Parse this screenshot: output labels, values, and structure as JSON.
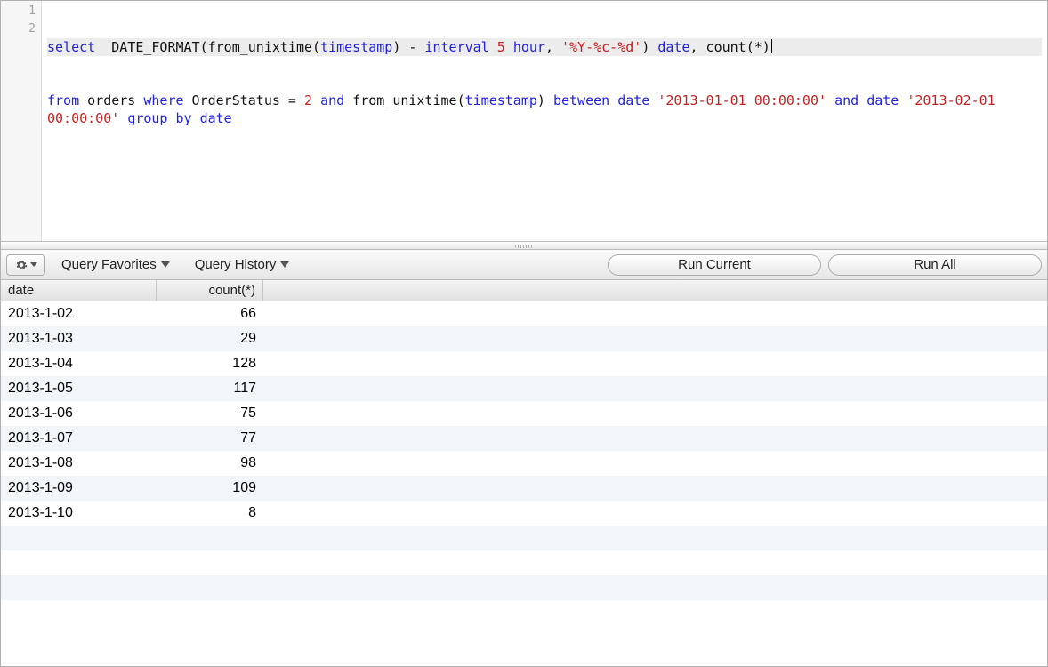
{
  "editor": {
    "line_numbers": [
      "1",
      "2"
    ],
    "tokens_line1": [
      {
        "t": "select",
        "c": "kw"
      },
      {
        "t": "  ",
        "c": ""
      },
      {
        "t": "DATE_FORMAT",
        "c": "fn"
      },
      {
        "t": "(",
        "c": ""
      },
      {
        "t": "from_unixtime",
        "c": "fn"
      },
      {
        "t": "(",
        "c": ""
      },
      {
        "t": "timestamp",
        "c": "kw"
      },
      {
        "t": ") - ",
        "c": ""
      },
      {
        "t": "interval",
        "c": "kw"
      },
      {
        "t": " ",
        "c": ""
      },
      {
        "t": "5",
        "c": "num"
      },
      {
        "t": " ",
        "c": ""
      },
      {
        "t": "hour",
        "c": "kw"
      },
      {
        "t": ", ",
        "c": ""
      },
      {
        "t": "'%Y-%c-%d'",
        "c": "str"
      },
      {
        "t": ") ",
        "c": ""
      },
      {
        "t": "date",
        "c": "kw"
      },
      {
        "t": ", count(*)",
        "c": ""
      }
    ],
    "tokens_line2": [
      {
        "t": "from",
        "c": "kw"
      },
      {
        "t": " orders ",
        "c": ""
      },
      {
        "t": "where",
        "c": "kw"
      },
      {
        "t": " OrderStatus = ",
        "c": ""
      },
      {
        "t": "2",
        "c": "num"
      },
      {
        "t": " ",
        "c": ""
      },
      {
        "t": "and",
        "c": "kw"
      },
      {
        "t": " ",
        "c": ""
      },
      {
        "t": "from_unixtime",
        "c": "fn"
      },
      {
        "t": "(",
        "c": ""
      },
      {
        "t": "timestamp",
        "c": "kw"
      },
      {
        "t": ") ",
        "c": ""
      },
      {
        "t": "between",
        "c": "kw"
      },
      {
        "t": " ",
        "c": ""
      },
      {
        "t": "date",
        "c": "kw"
      },
      {
        "t": " ",
        "c": ""
      },
      {
        "t": "'2013-01-01 00:00:00'",
        "c": "str"
      },
      {
        "t": " ",
        "c": ""
      },
      {
        "t": "and",
        "c": "kw"
      },
      {
        "t": " ",
        "c": ""
      },
      {
        "t": "date",
        "c": "kw"
      },
      {
        "t": " ",
        "c": ""
      },
      {
        "t": "'2013-02-01 00:00:00'",
        "c": "str"
      },
      {
        "t": " ",
        "c": ""
      },
      {
        "t": "group by",
        "c": "kw"
      },
      {
        "t": " ",
        "c": ""
      },
      {
        "t": "date",
        "c": "kw"
      }
    ]
  },
  "toolbar": {
    "favorites_label": "Query Favorites",
    "history_label": "Query History",
    "run_current_label": "Run Current",
    "run_all_label": "Run All"
  },
  "results": {
    "columns": [
      "date",
      "count(*)"
    ],
    "rows": [
      {
        "date": "2013-1-02",
        "count": "66"
      },
      {
        "date": "2013-1-03",
        "count": "29"
      },
      {
        "date": "2013-1-04",
        "count": "128"
      },
      {
        "date": "2013-1-05",
        "count": "117"
      },
      {
        "date": "2013-1-06",
        "count": "75"
      },
      {
        "date": "2013-1-07",
        "count": "77"
      },
      {
        "date": "2013-1-08",
        "count": "98"
      },
      {
        "date": "2013-1-09",
        "count": "109"
      },
      {
        "date": "2013-1-10",
        "count": "8"
      }
    ]
  }
}
